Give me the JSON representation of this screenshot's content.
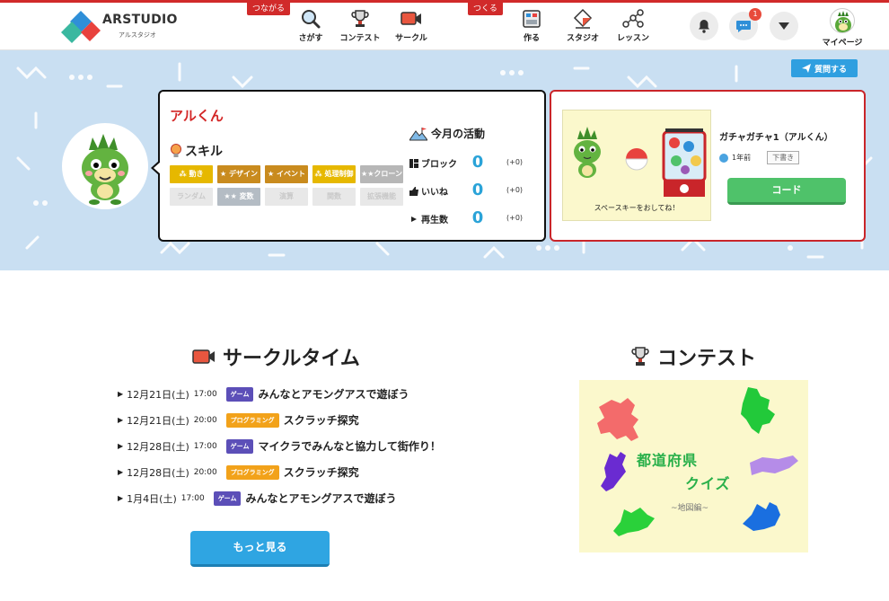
{
  "header": {
    "logo_text": "ARSTUDIO",
    "logo_sub": "アルスタジオ",
    "group_connect": "つながる",
    "group_create": "つくる",
    "nav": [
      {
        "label": "さがす",
        "icon": "search-icon"
      },
      {
        "label": "コンテスト",
        "icon": "trophy-icon"
      },
      {
        "label": "サークル",
        "icon": "video-icon"
      },
      {
        "label": "作る",
        "icon": "blocks-icon"
      },
      {
        "label": "スタジオ",
        "icon": "studio-icon"
      },
      {
        "label": "レッスン",
        "icon": "lesson-icon"
      }
    ],
    "notification_icon": "bell-icon",
    "message_icon": "chat-icon",
    "message_count": "1",
    "menu_icon": "chevron-down-icon",
    "mypage_label": "マイページ"
  },
  "banner": {
    "question_label": "質問する",
    "username": "アルくん",
    "skill_title": "スキル",
    "skills": [
      {
        "label": "動き",
        "active": true,
        "color": "#e6b800"
      },
      {
        "label": "デザイン",
        "active": true,
        "color": "#c98b1e"
      },
      {
        "label": "イベント",
        "active": true,
        "color": "#c98b1e"
      },
      {
        "label": "処理制御",
        "active": true,
        "color": "#e6b800"
      },
      {
        "label": "クローン",
        "active": true,
        "color": "#b7b7b7"
      },
      {
        "label": "ランダム",
        "active": false,
        "color": "#e8e8e8"
      },
      {
        "label": "変数",
        "active": true,
        "color": "#b4bcc4"
      },
      {
        "label": "演算",
        "active": false,
        "color": "#e8e8e8"
      },
      {
        "label": "関数",
        "active": false,
        "color": "#e8e8e8"
      },
      {
        "label": "拡張機能",
        "active": false,
        "color": "#e8e8e8"
      }
    ],
    "activity_title": "今月の活動",
    "activities": [
      {
        "label": "ブロック",
        "icon": "block-icon",
        "value": "0",
        "diff": "(+0)"
      },
      {
        "label": "いいね",
        "icon": "thumbs-up-icon",
        "value": "0",
        "diff": "(+0)"
      },
      {
        "label": "再生数",
        "icon": "play-icon",
        "value": "0",
        "diff": "(+0)"
      }
    ],
    "work": {
      "title": "ガチャガチャ1（アルくん）",
      "time": "1年前",
      "status": "下書き",
      "caption": "スペースキーをおしてね！",
      "code_label": "コード"
    }
  },
  "circle": {
    "title": "サークルタイム",
    "events": [
      {
        "date": "12月21日(土)",
        "time": "17:00",
        "tag": "ゲーム",
        "tag_color": "#5c4fb8",
        "title": "みんなとアモングアスで遊ぼう"
      },
      {
        "date": "12月21日(土)",
        "time": "20:00",
        "tag": "プログラミング",
        "tag_color": "#f2a21a",
        "title": "スクラッチ探究"
      },
      {
        "date": "12月28日(土)",
        "time": "17:00",
        "tag": "ゲーム",
        "tag_color": "#5c4fb8",
        "title": "マイクラでみんなと協力して街作り！"
      },
      {
        "date": "12月28日(土)",
        "time": "20:00",
        "tag": "プログラミング",
        "tag_color": "#f2a21a",
        "title": "スクラッチ探究"
      },
      {
        "date": "1月4日(土)",
        "time": "17:00",
        "tag": "ゲーム",
        "tag_color": "#5c4fb8",
        "title": "みんなとアモングアスで遊ぼう"
      }
    ],
    "more_label": "もっと見る"
  },
  "contest": {
    "title": "コンテスト",
    "image_line1": "都道府県",
    "image_line2": "クイズ",
    "image_line3": "~地図編~"
  }
}
